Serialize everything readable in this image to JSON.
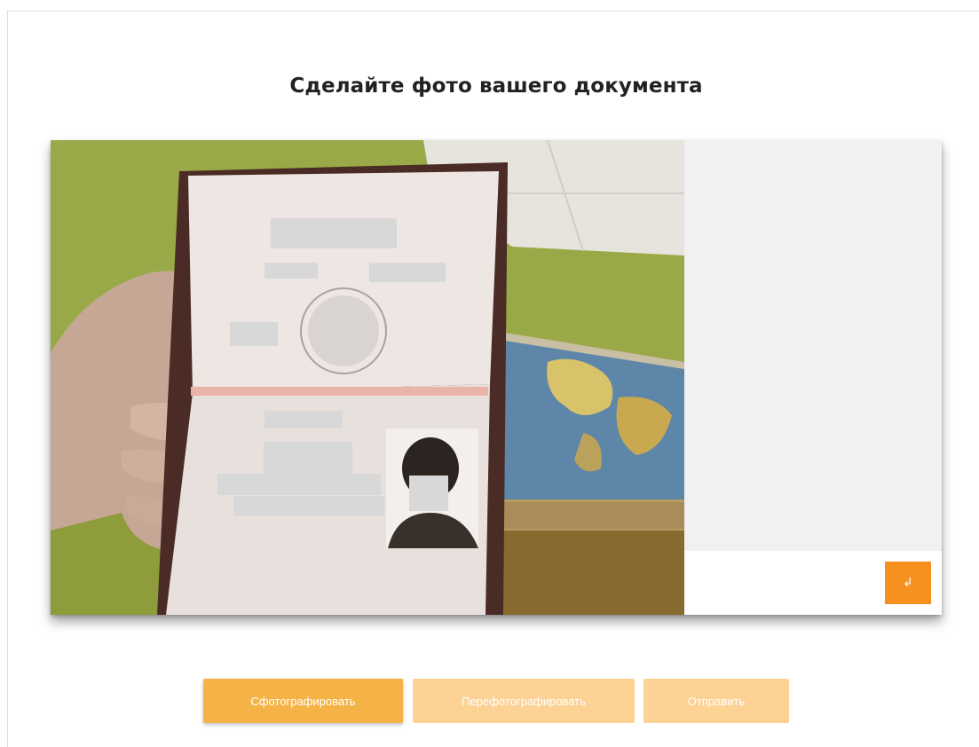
{
  "page": {
    "title": "Сделайте фото вашего документа"
  },
  "camera": {
    "alt": "Camera feed showing an open passport held in hand"
  },
  "preview": {
    "rotate_icon": "rotate-icon",
    "rotate_glyph": "↲"
  },
  "actions": {
    "capture_label": "Сфотографировать",
    "retake_label": "Перефотографировать",
    "send_label": "Отправить"
  },
  "colors": {
    "accent": "#f6901e",
    "capture_button": "#f5b347",
    "disabled_button": "#fcd295"
  }
}
